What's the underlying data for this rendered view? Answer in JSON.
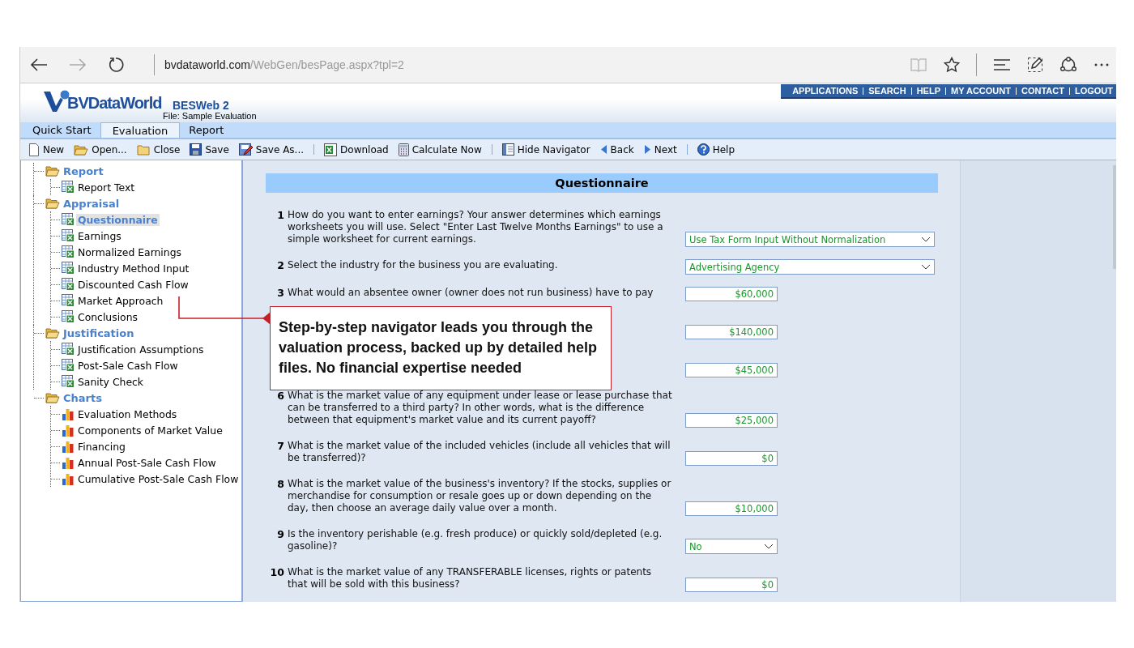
{
  "browser": {
    "url_host": "bvdataworld.com",
    "url_path": "/WebGen/besPage.aspx?tpl=2"
  },
  "header": {
    "logo": "BVDataWorld",
    "product": "BESWeb 2",
    "file": "File: Sample Evaluation",
    "links": [
      "APPLICATIONS",
      "SEARCH",
      "HELP",
      "MY ACCOUNT",
      "CONTACT",
      "LOGOUT"
    ]
  },
  "tabs": [
    {
      "label": "Quick Start",
      "selected": false
    },
    {
      "label": "Evaluation",
      "selected": true
    },
    {
      "label": "Report",
      "selected": false
    }
  ],
  "toolbar": [
    {
      "kind": "new",
      "label": "New"
    },
    {
      "kind": "open",
      "label": "Open..."
    },
    {
      "kind": "close",
      "label": "Close"
    },
    {
      "kind": "save",
      "label": "Save"
    },
    {
      "kind": "saveas",
      "label": "Save As..."
    },
    {
      "kind": "separator"
    },
    {
      "kind": "download",
      "label": "Download"
    },
    {
      "kind": "calculate",
      "label": "Calculate Now"
    },
    {
      "kind": "separator"
    },
    {
      "kind": "navigator",
      "label": "Hide Navigator"
    },
    {
      "kind": "back",
      "label": "Back"
    },
    {
      "kind": "next",
      "label": "Next"
    },
    {
      "kind": "separator"
    },
    {
      "kind": "help",
      "label": "Help"
    }
  ],
  "navigator": [
    {
      "label": "Report",
      "selected": false,
      "children": [
        {
          "label": "Report Text",
          "kind": "sheet",
          "selected": false
        }
      ]
    },
    {
      "label": "Appraisal",
      "selected": false,
      "children": [
        {
          "label": "Questionnaire",
          "kind": "sheet",
          "selected": true
        },
        {
          "label": "Earnings",
          "kind": "sheet",
          "selected": false
        },
        {
          "label": "Normalized Earnings",
          "kind": "sheet",
          "selected": false
        },
        {
          "label": "Industry Method Input",
          "kind": "sheet",
          "selected": false
        },
        {
          "label": "Discounted Cash Flow",
          "kind": "sheet",
          "selected": false
        },
        {
          "label": "Market Approach",
          "kind": "sheet",
          "selected": false
        },
        {
          "label": "Conclusions",
          "kind": "sheet",
          "selected": false
        }
      ]
    },
    {
      "label": "Justification",
      "selected": false,
      "children": [
        {
          "label": "Justification Assumptions",
          "kind": "sheet",
          "selected": false
        },
        {
          "label": "Post-Sale Cash Flow",
          "kind": "sheet",
          "selected": false
        },
        {
          "label": "Sanity Check",
          "kind": "sheet",
          "selected": false
        }
      ]
    },
    {
      "label": "Charts",
      "selected": false,
      "children": [
        {
          "label": "Evaluation Methods",
          "kind": "chart",
          "selected": false
        },
        {
          "label": "Components of Market Value",
          "kind": "chart",
          "selected": false
        },
        {
          "label": "Financing",
          "kind": "chart",
          "selected": false
        },
        {
          "label": "Annual Post-Sale Cash Flow",
          "kind": "chart",
          "selected": false
        },
        {
          "label": "Cumulative Post-Sale Cash Flow",
          "kind": "chart",
          "selected": false
        }
      ]
    }
  ],
  "questionnaire": {
    "title": "Questionnaire",
    "questions": [
      {
        "number": "1",
        "text": "How do you want to enter earnings? Your answer determines which earnings worksheets you will use. Select \"Enter Last Twelve Months Earnings\" to use a simple worksheet for current earnings.",
        "kind": "select",
        "answer": "Use Tax Form Input Without Normalization"
      },
      {
        "number": "2",
        "text": "Select the industry for the business you are evaluating.",
        "kind": "select",
        "answer": "Advertising Agency"
      },
      {
        "number": "3",
        "text": "What would an absentee owner (owner does not run business) have to pay",
        "kind": "amount",
        "answer": "$60,000"
      },
      {
        "kind": "amount",
        "answer": "$140,000"
      },
      {
        "kind": "amount",
        "answer": "$45,000"
      },
      {
        "number": "6",
        "text": "What is the market value of any equipment under lease or lease purchase that can be transferred to a third party? In other words, what is the difference between that equipment's market value and its current payoff?",
        "kind": "amount",
        "answer": "$25,000"
      },
      {
        "number": "7",
        "text": "What is the market value of the included vehicles (include all vehicles that will be transferred)?",
        "kind": "amount",
        "answer": "$0"
      },
      {
        "number": "8",
        "text": "What is the market value of the business's inventory? If the stocks, supplies or merchandise for consumption or resale goes up or down depending on the day, then choose an average daily value over a month.",
        "kind": "amount",
        "answer": "$10,000"
      },
      {
        "number": "9",
        "text": "Is the inventory perishable (e.g. fresh produce) or quickly sold/depleted (e.g. gasoline)?",
        "kind": "shortselect",
        "answer": "No"
      },
      {
        "number": "10",
        "text": "What is the market value of any TRANSFERABLE licenses, rights or patents that will be sold with this business?",
        "kind": "amount",
        "answer": "$0"
      }
    ]
  },
  "callout": {
    "text": "Step-by-step navigator leads you through the valuation process, backed up by detailed help files. No financial expertise needed"
  }
}
